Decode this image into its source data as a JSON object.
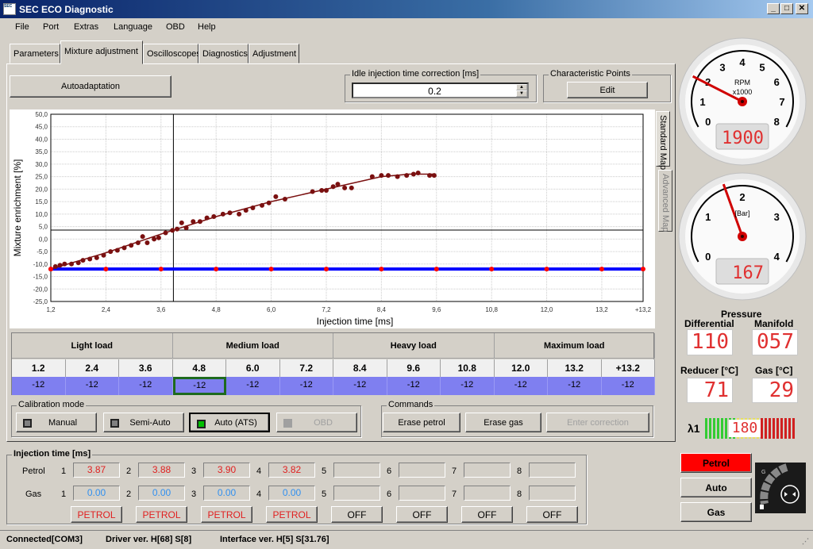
{
  "window": {
    "title": "SEC ECO Diagnostic",
    "app_icon_text": "SEC",
    "controls": [
      "_",
      "□",
      "✕"
    ]
  },
  "menu": [
    "File",
    "Port",
    "Extras",
    "Language",
    "OBD",
    "Help"
  ],
  "tabs": [
    {
      "label": "Parameters",
      "active": false
    },
    {
      "label": "Mixture adjustment",
      "active": true
    },
    {
      "label": "Oscilloscopes",
      "active": false
    },
    {
      "label": "Diagnostics",
      "active": false
    },
    {
      "label": "Adjustment",
      "active": false
    }
  ],
  "toolbar": {
    "autoadaptation_label": "Autoadaptation",
    "idle_group_label": "Idle injection time correction [ms]",
    "idle_value": "0.2",
    "char_points_label": "Characteristic Points",
    "edit_label": "Edit"
  },
  "side_tabs": {
    "standard": "Standard Map",
    "advanced": "Advanced Map"
  },
  "chart_data": {
    "type": "scatter",
    "xlabel": "Injection time [ms]",
    "ylabel": "Mixture enrichment [%]",
    "xlim": [
      1.2,
      14.1
    ],
    "ylim": [
      -25,
      50
    ],
    "x_ticks": [
      1.2,
      2.4,
      3.6,
      4.8,
      6.0,
      7.2,
      8.4,
      9.6,
      10.8,
      12.0,
      13.2,
      14.1
    ],
    "x_tick_labels": [
      "1,2",
      "2,4",
      "3,6",
      "4,8",
      "6,0",
      "7,2",
      "8,4",
      "9,6",
      "10,8",
      "12,0",
      "13,2",
      "+13,2"
    ],
    "y_ticks": [
      50,
      45,
      40,
      35,
      30,
      25,
      20,
      15,
      10,
      5,
      0,
      -5,
      -10,
      -15,
      -20,
      -25
    ],
    "y_tick_labels": [
      "50,0",
      "45,0",
      "40,0",
      "35,0",
      "30,0",
      "25,0",
      "20,0",
      "15,0",
      "10,0",
      "5,0",
      "0,0",
      "-5,0",
      "-10,0",
      "-15,0",
      "-20,0",
      "-25,0"
    ],
    "grid": true,
    "cursor": {
      "x": 3.87,
      "y": 3.6
    },
    "measured_points": [
      [
        1.2,
        -12
      ],
      [
        1.3,
        -11
      ],
      [
        1.4,
        -10.5
      ],
      [
        1.5,
        -10
      ],
      [
        1.65,
        -10
      ],
      [
        1.8,
        -9.5
      ],
      [
        1.9,
        -8.5
      ],
      [
        2.05,
        -8
      ],
      [
        2.2,
        -7.5
      ],
      [
        2.35,
        -6.5
      ],
      [
        2.5,
        -5
      ],
      [
        2.65,
        -4.5
      ],
      [
        2.8,
        -3.5
      ],
      [
        2.95,
        -2.5
      ],
      [
        3.1,
        -1.5
      ],
      [
        3.2,
        1
      ],
      [
        3.3,
        -1.5
      ],
      [
        3.45,
        0
      ],
      [
        3.55,
        0.5
      ],
      [
        3.7,
        2.5
      ],
      [
        3.85,
        3.5
      ],
      [
        3.95,
        4
      ],
      [
        4.05,
        6.5
      ],
      [
        4.15,
        4.5
      ],
      [
        4.3,
        7
      ],
      [
        4.45,
        7
      ],
      [
        4.6,
        8.5
      ],
      [
        4.75,
        9
      ],
      [
        4.95,
        10
      ],
      [
        5.1,
        10.5
      ],
      [
        5.3,
        10
      ],
      [
        5.45,
        11.5
      ],
      [
        5.6,
        12.5
      ],
      [
        5.8,
        13.5
      ],
      [
        5.95,
        14.5
      ],
      [
        6.1,
        17
      ],
      [
        6.3,
        16
      ],
      [
        6.9,
        19
      ],
      [
        7.1,
        19.5
      ],
      [
        7.2,
        19.5
      ],
      [
        7.35,
        21
      ],
      [
        7.45,
        22
      ],
      [
        7.6,
        20.5
      ],
      [
        7.75,
        20.5
      ],
      [
        8.2,
        25
      ],
      [
        8.4,
        25.5
      ],
      [
        8.55,
        25.5
      ],
      [
        8.75,
        25
      ],
      [
        8.95,
        25.5
      ],
      [
        9.1,
        26
      ],
      [
        9.2,
        26.5
      ],
      [
        9.45,
        25.5
      ],
      [
        9.55,
        25.5
      ]
    ],
    "trend_line": [
      [
        1.2,
        -12
      ],
      [
        2.4,
        -5.5
      ],
      [
        3.6,
        2
      ],
      [
        4.8,
        9
      ],
      [
        6.0,
        15
      ],
      [
        7.2,
        20
      ],
      [
        8.4,
        25
      ],
      [
        9.0,
        26
      ],
      [
        9.55,
        26
      ]
    ],
    "map_series": {
      "x": [
        1.2,
        2.4,
        3.6,
        4.8,
        6.0,
        7.2,
        8.4,
        9.6,
        10.8,
        12.0,
        13.2,
        14.1
      ],
      "y": [
        -12,
        -12,
        -12,
        -12,
        -12,
        -12,
        -12,
        -12,
        -12,
        -12,
        -12,
        -12
      ]
    },
    "colors": {
      "points": "#7a1010",
      "map_line": "#0000ff",
      "map_points": "#ff0000"
    }
  },
  "map_table": {
    "groups": [
      "Light load",
      "Medium load",
      "Heavy load",
      "Maximum load"
    ],
    "columns": [
      "1.2",
      "2.4",
      "3.6",
      "4.8",
      "6.0",
      "7.2",
      "8.4",
      "9.6",
      "10.8",
      "12.0",
      "13.2",
      "+13.2"
    ],
    "values": [
      "-12",
      "-12",
      "-12",
      "-12",
      "-12",
      "-12",
      "-12",
      "-12",
      "-12",
      "-12",
      "-12",
      "-12"
    ],
    "selected_index": 3
  },
  "calibration": {
    "label": "Calibration mode",
    "buttons": [
      {
        "label": "Manual",
        "led": "#808080",
        "enabled": true
      },
      {
        "label": "Semi-Auto",
        "led": "#808080",
        "enabled": true
      },
      {
        "label": "Auto (ATS)",
        "led": "#00c000",
        "enabled": true,
        "active": true
      },
      {
        "label": "OBD",
        "led": "#a0a0a0",
        "enabled": false
      }
    ]
  },
  "commands": {
    "label": "Commands",
    "buttons": [
      {
        "label": "Erase petrol",
        "enabled": true
      },
      {
        "label": "Erase gas",
        "enabled": true
      },
      {
        "label": "Enter correction",
        "enabled": false
      }
    ]
  },
  "injection": {
    "label": "Injection time [ms]",
    "petrol_label": "Petrol",
    "gas_label": "Gas",
    "cylinders": [
      "1",
      "2",
      "3",
      "4",
      "5",
      "6",
      "7",
      "8"
    ],
    "petrol": [
      "3.87",
      "3.88",
      "3.90",
      "3.82",
      "",
      "",
      "",
      ""
    ],
    "gas": [
      "0.00",
      "0.00",
      "0.00",
      "0.00",
      "",
      "",
      "",
      ""
    ],
    "modes": [
      "PETROL",
      "PETROL",
      "PETROL",
      "PETROL",
      "OFF",
      "OFF",
      "OFF",
      "OFF"
    ]
  },
  "status": {
    "connection": "Connected[COM3]",
    "driver": "Driver ver. H[68] S[8]",
    "interface": "Interface ver. H[5] S[31.76]"
  },
  "rpm_gauge": {
    "ticks": [
      "0",
      "1",
      "2",
      "3",
      "4",
      "5",
      "6",
      "7",
      "8"
    ],
    "unit1": "RPM",
    "unit2": "x1000",
    "value": 1900,
    "display": "1900",
    "max": 8000
  },
  "pressure_gauge": {
    "ticks": [
      "0",
      "1",
      "2",
      "3",
      "4"
    ],
    "unit": "[Bar]",
    "value": 1.67,
    "display": "167",
    "max": 4
  },
  "readouts": {
    "pressure_title": "Pressure",
    "differential_label": "Differential",
    "differential": "110",
    "manifold_label": "Manifold",
    "manifold": "057",
    "reducer_label": "Reducer [°C]",
    "reducer": "71",
    "gas_label": "Gas [°C]",
    "gas": "29"
  },
  "lambda": {
    "label": "λ1",
    "display": "180"
  },
  "fuel_mode": {
    "petrol": "Petrol",
    "auto": "Auto",
    "gas": "Gas",
    "active": "petrol",
    "active_color": "#ff0000"
  },
  "switch_widget": {
    "label_top": "G"
  }
}
